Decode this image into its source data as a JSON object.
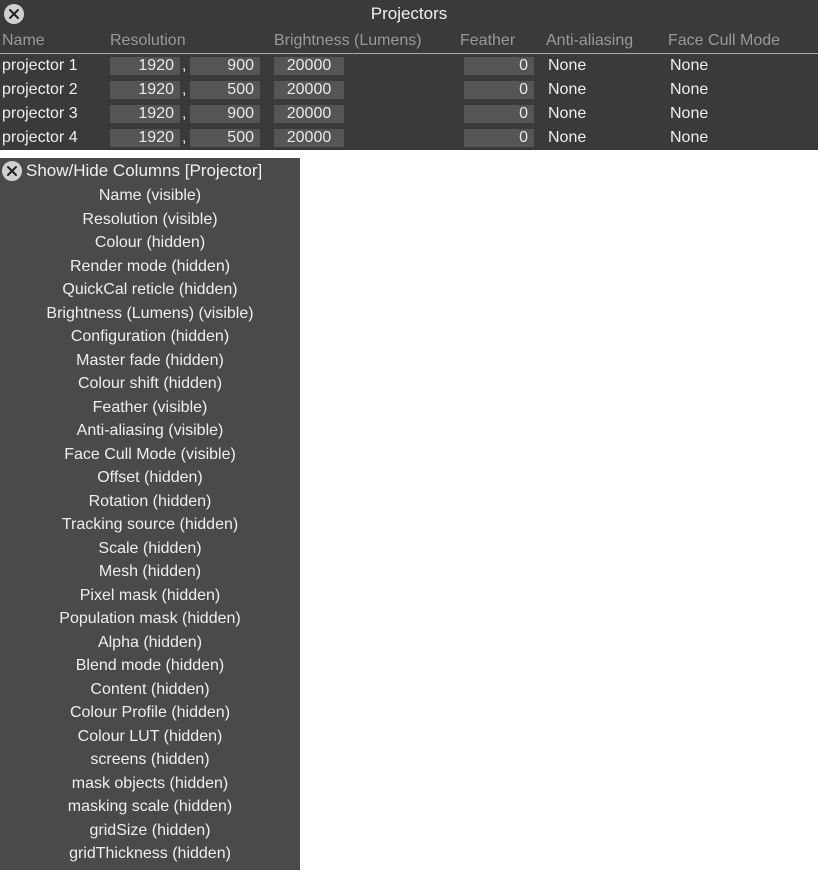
{
  "main": {
    "title": "Projectors",
    "headers": {
      "name": "Name",
      "resolution": "Resolution",
      "brightness": "Brightness (Lumens)",
      "feather": "Feather",
      "aa": "Anti-aliasing",
      "facecull": "Face Cull Mode"
    },
    "rows": [
      {
        "name": "projector 1",
        "res_w": "1920",
        "res_h": "900",
        "bright": "20000",
        "feather": "0",
        "aa": "None",
        "facecull": "None"
      },
      {
        "name": "projector 2",
        "res_w": "1920",
        "res_h": "500",
        "bright": "20000",
        "feather": "0",
        "aa": "None",
        "facecull": "None"
      },
      {
        "name": "projector 3",
        "res_w": "1920",
        "res_h": "900",
        "bright": "20000",
        "feather": "0",
        "aa": "None",
        "facecull": "None"
      },
      {
        "name": "projector 4",
        "res_w": "1920",
        "res_h": "500",
        "bright": "20000",
        "feather": "0",
        "aa": "None",
        "facecull": "None"
      }
    ]
  },
  "columns_panel": {
    "title": "Show/Hide Columns [Projector]",
    "items": [
      "Name (visible)",
      "Resolution (visible)",
      "Colour (hidden)",
      "Render mode (hidden)",
      "QuickCal reticle (hidden)",
      "Brightness (Lumens) (visible)",
      "Configuration (hidden)",
      "Master fade (hidden)",
      "Colour shift (hidden)",
      "Feather (visible)",
      "Anti-aliasing (visible)",
      "Face Cull Mode (visible)",
      "Offset (hidden)",
      "Rotation (hidden)",
      "Tracking source (hidden)",
      "Scale (hidden)",
      "Mesh (hidden)",
      "Pixel mask (hidden)",
      "Population mask (hidden)",
      "Alpha (hidden)",
      "Blend mode (hidden)",
      "Content (hidden)",
      "Colour Profile (hidden)",
      "Colour LUT (hidden)",
      "screens (hidden)",
      "mask objects (hidden)",
      "masking scale (hidden)",
      "gridSize (hidden)",
      "gridThickness (hidden)"
    ]
  }
}
